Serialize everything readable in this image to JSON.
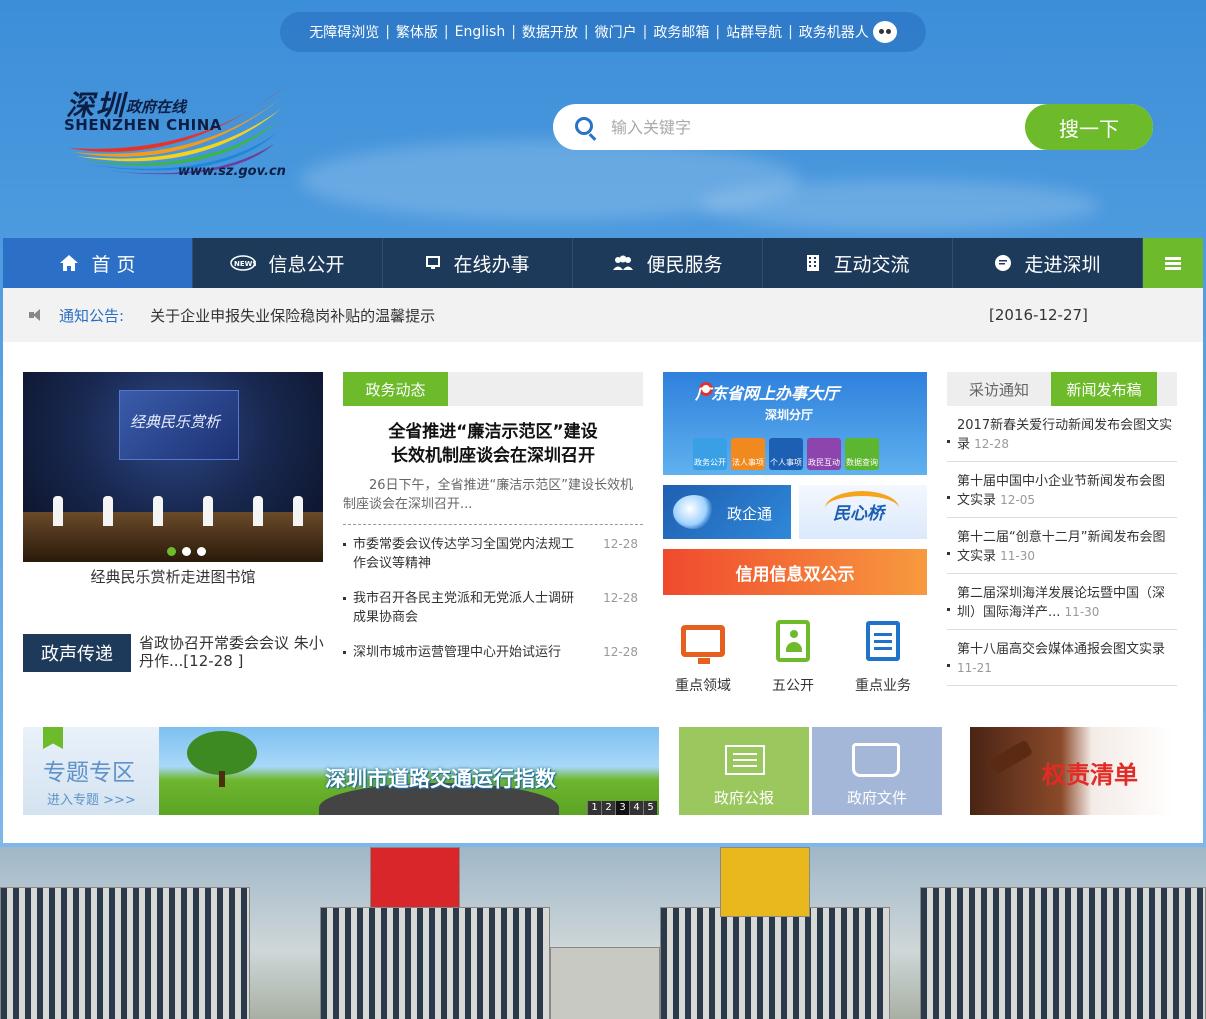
{
  "topbar": {
    "links": [
      "无障碍浏览",
      "繁体版",
      "English",
      "数据开放",
      "微门户",
      "政务邮箱",
      "站群导航",
      "政务机器人"
    ]
  },
  "logo": {
    "cn_main": "深圳",
    "cn_sub": "政府在线",
    "en": "SHENZHEN CHINA",
    "url": "www.sz.gov.cn"
  },
  "search": {
    "placeholder": "输入关键字",
    "button": "搜一下"
  },
  "nav": {
    "items": [
      {
        "label": "首 页",
        "icon": "home-icon"
      },
      {
        "label": "信息公开",
        "icon": "news-icon"
      },
      {
        "label": "在线办事",
        "icon": "monitor-icon"
      },
      {
        "label": "便民服务",
        "icon": "people-icon"
      },
      {
        "label": "互动交流",
        "icon": "building-icon"
      },
      {
        "label": "走进深圳",
        "icon": "chat-icon"
      }
    ],
    "menu_icon": "hamburger-icon"
  },
  "notice": {
    "label": "通知公告:",
    "text": "关于企业申报失业保险稳岗补贴的温馨提示",
    "date": "[2016-12-27]"
  },
  "photo": {
    "screen_text": "经典民乐赏析",
    "caption": "经典民乐赏析走进图书馆"
  },
  "zhengsheng": {
    "tag": "政声传递",
    "text": "省政协召开常委会会议 朱小丹作...[12-28 ]"
  },
  "news": {
    "tab": "政务动态",
    "headline_line1": "全省推进“廉洁示范区”建设",
    "headline_line2": "长效机制座谈会在深圳召开",
    "summary": "26日下午，全省推进“廉洁示范区”建设长效机制座谈会在深圳召开...",
    "items": [
      {
        "title": "市委常委会议传达学习全国党内法规工作会议等精神",
        "date": "12-28"
      },
      {
        "title": "我市召开各民主党派和无党派人士调研成果协商会",
        "date": "12-28"
      },
      {
        "title": "深圳市城市运营管理中心开始试运行",
        "date": "12-28"
      }
    ]
  },
  "services": {
    "gd_title": "广东省网上办事大厅",
    "gd_sub": "深圳分厅",
    "gd_badges": [
      "政务公开",
      "法人事项",
      "个人事项",
      "政民互动",
      "数据查询"
    ],
    "zqt": "政企通",
    "mxq": "民心桥",
    "xinyong": "信用信息双公示",
    "icons": [
      {
        "label": "重点领域",
        "icon": "monitor-icon"
      },
      {
        "label": "五公开",
        "icon": "contact-book-icon"
      },
      {
        "label": "重点业务",
        "icon": "document-edit-icon"
      }
    ]
  },
  "press": {
    "tab1": "采访通知",
    "tab2": "新闻发布稿",
    "items": [
      {
        "title": "2017新春关爱行动新闻发布会图文实录",
        "date": "12-28"
      },
      {
        "title": "第十届中国中小企业节新闻发布会图文实录",
        "date": "12-05"
      },
      {
        "title": "第十二届“创意十二月”新闻发布会图文实录",
        "date": "11-30"
      },
      {
        "title": "第二届深圳海洋发展论坛暨中国（深圳）国际海洋产...",
        "date": "11-30"
      },
      {
        "title": "第十八届高交会媒体通报会图文实录",
        "date": "11-21"
      }
    ]
  },
  "banners": {
    "zt_title": "专题专区",
    "zt_sub": "进入专题 >>>",
    "road_title": "深圳市道路交通运行指数",
    "road_pages": [
      "1",
      "2",
      "3",
      "4",
      "5"
    ],
    "gb": "政府公报",
    "gw": "政府文件",
    "qz": "权责清单"
  },
  "colors": {
    "accent_green": "#6dbb2b",
    "nav_dark": "#1e3a5a",
    "nav_active": "#2b6fc6"
  }
}
